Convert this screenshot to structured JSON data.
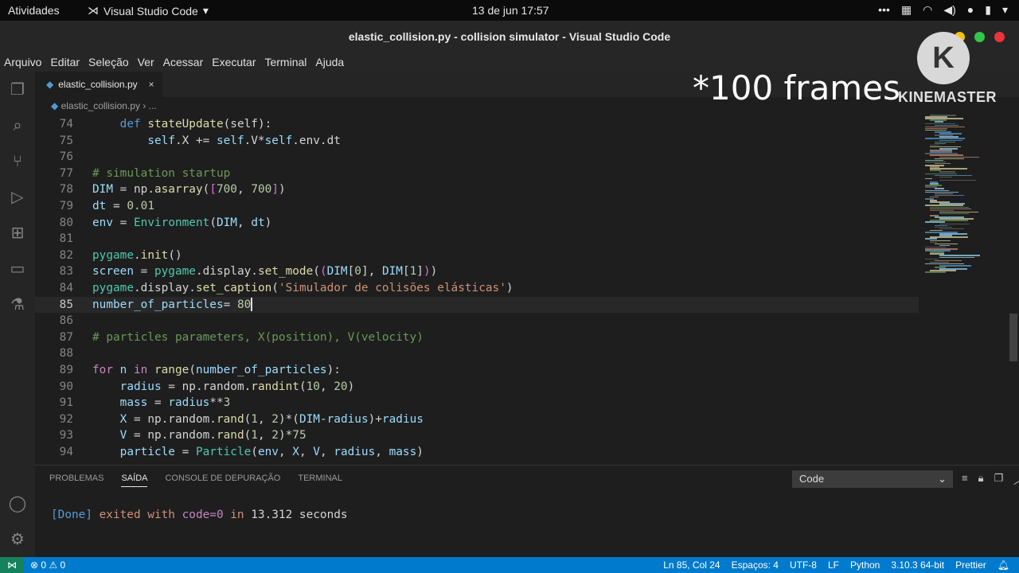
{
  "topbar": {
    "activities": "Atividades",
    "app_name": "Visual Studio Code",
    "clock": "13 de jun  17:57"
  },
  "window": {
    "title": "elastic_collision.py - collision simulator - Visual Studio Code",
    "buttons": {
      "minimize_color": "#f5c211",
      "maximize_color": "#33c748",
      "close_color": "#ed333b"
    }
  },
  "menu": [
    "Arquivo",
    "Editar",
    "Seleção",
    "Ver",
    "Acessar",
    "Executar",
    "Terminal",
    "Ajuda"
  ],
  "activity_icons": [
    "files-icon",
    "search-icon",
    "source-control-icon",
    "run-debug-icon",
    "extensions-icon",
    "remote-explorer-icon",
    "testing-icon",
    "account-icon",
    "settings-icon"
  ],
  "tab": {
    "label": "elastic_collision.py",
    "close": "×"
  },
  "breadcrumb": {
    "file": "elastic_collision.py",
    "more": "..."
  },
  "overlay": {
    "text": "*100 frames",
    "logo_letter": "K",
    "brand": "KINEMASTER"
  },
  "code_lines": [
    {
      "n": "74",
      "cur": false,
      "tokens": [
        [
          "",
          "    "
        ],
        [
          "kw",
          "def "
        ],
        [
          "fn",
          "stateUpdate"
        ],
        [
          "",
          "(self):"
        ]
      ]
    },
    {
      "n": "75",
      "cur": false,
      "tokens": [
        [
          "",
          "        "
        ],
        [
          "var",
          "self"
        ],
        [
          "",
          ".X += "
        ],
        [
          "var",
          "self"
        ],
        [
          "",
          ".V*"
        ],
        [
          "var",
          "self"
        ],
        [
          "",
          ".env.dt"
        ]
      ]
    },
    {
      "n": "76",
      "cur": false,
      "tokens": []
    },
    {
      "n": "77",
      "cur": false,
      "tokens": [
        [
          "cm",
          "# simulation startup"
        ]
      ]
    },
    {
      "n": "78",
      "cur": false,
      "tokens": [
        [
          "var",
          "DIM"
        ],
        [
          "",
          " = np."
        ],
        [
          "fn",
          "asarray"
        ],
        [
          "",
          "("
        ],
        [
          "br",
          "["
        ],
        [
          "num",
          "700"
        ],
        [
          "",
          ", "
        ],
        [
          "num",
          "700"
        ],
        [
          "br",
          "]"
        ],
        [
          "",
          ")"
        ]
      ]
    },
    {
      "n": "79",
      "cur": false,
      "tokens": [
        [
          "var",
          "dt"
        ],
        [
          "",
          " = "
        ],
        [
          "num",
          "0.01"
        ]
      ]
    },
    {
      "n": "80",
      "cur": false,
      "tokens": [
        [
          "var",
          "env"
        ],
        [
          "",
          " = "
        ],
        [
          "cls",
          "Environment"
        ],
        [
          "",
          "("
        ],
        [
          "var",
          "DIM"
        ],
        [
          "",
          ", "
        ],
        [
          "var",
          "dt"
        ],
        [
          "",
          ")"
        ]
      ]
    },
    {
      "n": "81",
      "cur": false,
      "tokens": []
    },
    {
      "n": "82",
      "cur": false,
      "tokens": [
        [
          "cls",
          "pygame"
        ],
        [
          "",
          "."
        ],
        [
          "fn",
          "init"
        ],
        [
          "",
          "()"
        ]
      ]
    },
    {
      "n": "83",
      "cur": false,
      "tokens": [
        [
          "var",
          "screen"
        ],
        [
          "",
          " = "
        ],
        [
          "cls",
          "pygame"
        ],
        [
          "",
          ".display."
        ],
        [
          "fn",
          "set_mode"
        ],
        [
          "",
          "("
        ],
        [
          "br",
          "("
        ],
        [
          "var",
          "DIM"
        ],
        [
          "",
          "["
        ],
        [
          "num",
          "0"
        ],
        [
          "",
          "], "
        ],
        [
          "var",
          "DIM"
        ],
        [
          "",
          "["
        ],
        [
          "num",
          "1"
        ],
        [
          "",
          "]"
        ],
        [
          "br",
          ")"
        ],
        [
          "",
          ")"
        ]
      ]
    },
    {
      "n": "84",
      "cur": false,
      "tokens": [
        [
          "cls",
          "pygame"
        ],
        [
          "",
          ".display."
        ],
        [
          "fn",
          "set_caption"
        ],
        [
          "",
          "("
        ],
        [
          "str",
          "'Simulador de colisões elásticas'"
        ],
        [
          "",
          ")"
        ]
      ]
    },
    {
      "n": "85",
      "cur": true,
      "tokens": [
        [
          "var",
          "number_of_particles"
        ],
        [
          "",
          "= "
        ],
        [
          "num",
          "80"
        ]
      ]
    },
    {
      "n": "86",
      "cur": false,
      "tokens": []
    },
    {
      "n": "87",
      "cur": false,
      "tokens": [
        [
          "cm",
          "# particles parameters, X(position), V(velocity)"
        ]
      ]
    },
    {
      "n": "88",
      "cur": false,
      "tokens": []
    },
    {
      "n": "89",
      "cur": false,
      "tokens": [
        [
          "ctrl",
          "for "
        ],
        [
          "var",
          "n"
        ],
        [
          "ctrl",
          " in "
        ],
        [
          "fn",
          "range"
        ],
        [
          "",
          "("
        ],
        [
          "var",
          "number_of_particles"
        ],
        [
          "",
          "):"
        ]
      ]
    },
    {
      "n": "90",
      "cur": false,
      "tokens": [
        [
          "",
          "    "
        ],
        [
          "var",
          "radius"
        ],
        [
          "",
          " = np.random."
        ],
        [
          "fn",
          "randint"
        ],
        [
          "",
          "("
        ],
        [
          "num",
          "10"
        ],
        [
          "",
          ", "
        ],
        [
          "num",
          "20"
        ],
        [
          "",
          ")"
        ]
      ]
    },
    {
      "n": "91",
      "cur": false,
      "tokens": [
        [
          "",
          "    "
        ],
        [
          "var",
          "mass"
        ],
        [
          "",
          " = "
        ],
        [
          "var",
          "radius"
        ],
        [
          "",
          "**"
        ],
        [
          "num",
          "3"
        ]
      ]
    },
    {
      "n": "92",
      "cur": false,
      "tokens": [
        [
          "",
          "    "
        ],
        [
          "var",
          "X"
        ],
        [
          "",
          " = np.random."
        ],
        [
          "fn",
          "rand"
        ],
        [
          "",
          "("
        ],
        [
          "num",
          "1"
        ],
        [
          "",
          ", "
        ],
        [
          "num",
          "2"
        ],
        [
          "",
          ")*("
        ],
        [
          "var",
          "DIM"
        ],
        [
          "",
          "-"
        ],
        [
          "var",
          "radius"
        ],
        [
          "",
          ")+"
        ],
        [
          "var",
          "radius"
        ]
      ]
    },
    {
      "n": "93",
      "cur": false,
      "tokens": [
        [
          "",
          "    "
        ],
        [
          "var",
          "V"
        ],
        [
          "",
          " = np.random."
        ],
        [
          "fn",
          "rand"
        ],
        [
          "",
          "("
        ],
        [
          "num",
          "1"
        ],
        [
          "",
          ", "
        ],
        [
          "num",
          "2"
        ],
        [
          "",
          ")*"
        ],
        [
          "num",
          "75"
        ]
      ]
    },
    {
      "n": "94",
      "cur": false,
      "tokens": [
        [
          "",
          "    "
        ],
        [
          "var",
          "particle"
        ],
        [
          "",
          " = "
        ],
        [
          "cls",
          "Particle"
        ],
        [
          "",
          "("
        ],
        [
          "var",
          "env"
        ],
        [
          "",
          ", "
        ],
        [
          "var",
          "X"
        ],
        [
          "",
          ", "
        ],
        [
          "var",
          "V"
        ],
        [
          "",
          ", "
        ],
        [
          "var",
          "radius"
        ],
        [
          "",
          ", "
        ],
        [
          "var",
          "mass"
        ],
        [
          "",
          ")"
        ]
      ]
    }
  ],
  "panel": {
    "tabs": [
      "PROBLEMAS",
      "SAÍDA",
      "CONSOLE DE DEPURAÇÃO",
      "TERMINAL"
    ],
    "active_tab": "SAÍDA",
    "select_value": "Code",
    "output": {
      "done": "[Done]",
      "text1": " exited with ",
      "code": "code=0",
      "text2": " in ",
      "seconds": "13.312 seconds"
    }
  },
  "statusbar": {
    "errors": "⊗ 0 ⚠ 0",
    "position": "Ln 85, Col 24",
    "spaces": "Espaços: 4",
    "encoding": "UTF-8",
    "eol": "LF",
    "language": "Python",
    "interpreter": "3.10.3 64-bit",
    "prettier": "Prettier"
  }
}
